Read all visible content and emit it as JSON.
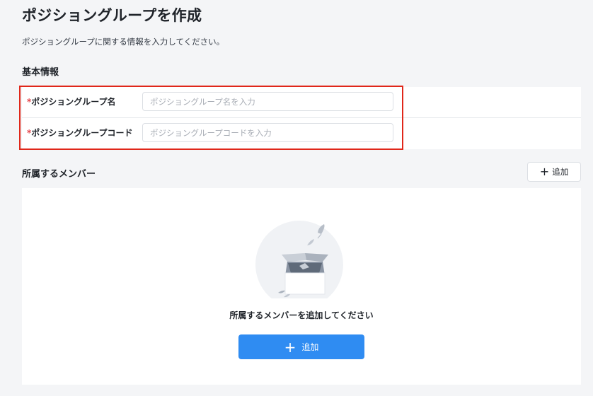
{
  "page": {
    "title": "ポジショングループを作成",
    "description": "ポジショングループに関する情報を入力してください。"
  },
  "basic_info": {
    "title": "基本情報",
    "fields": [
      {
        "required_mark": "*",
        "label": "ポジショングループ名",
        "value": "",
        "placeholder": "ポジショングループ名を入力"
      },
      {
        "required_mark": "*",
        "label": "ポジショングループコード",
        "value": "",
        "placeholder": "ポジショングループコードを入力"
      }
    ]
  },
  "members": {
    "title": "所属するメンバー",
    "add_label": "追加",
    "add_icon": "plus-icon",
    "empty_text": "所属するメンバーを追加してください",
    "empty_add_label": "追加",
    "empty_illustration": "empty-box-icon"
  },
  "colors": {
    "primary": "#2f8cf2",
    "required": "#e5484d",
    "highlight": "#e0271a",
    "background": "#f4f5f7"
  }
}
